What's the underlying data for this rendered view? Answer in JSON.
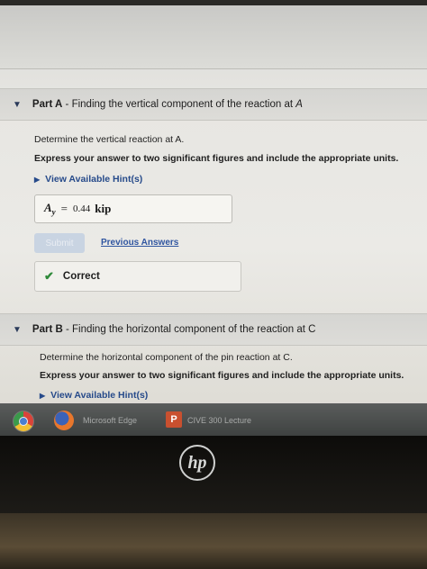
{
  "partA": {
    "label": "Part A",
    "title": " - Finding the vertical component of the reaction at ",
    "title_var": "A",
    "question": "Determine the vertical reaction at A.",
    "instruction": "Express your answer to two significant figures and include the appropriate units.",
    "hint_label": "View Available Hint(s)",
    "answer": {
      "variable": "A",
      "subscript": "y",
      "equals": "=",
      "value": "0.44",
      "unit": "kip"
    },
    "submit_label": "Submit",
    "previous_answers_label": "Previous Answers",
    "result_label": "Correct"
  },
  "partB": {
    "label": "Part B",
    "title": " - Finding the horizontal component of the reaction at C",
    "question": "Determine the horizontal component of the pin reaction at C.",
    "instruction": "Express your answer to two significant figures and include the appropriate units.",
    "hint_label": "View Available Hint(s)"
  },
  "taskbar": {
    "item1_label": "Microsoft Edge",
    "item2_letter": "P",
    "item2_label": "CIVE 300 Lecture"
  },
  "bezel": {
    "brand": "hp"
  }
}
